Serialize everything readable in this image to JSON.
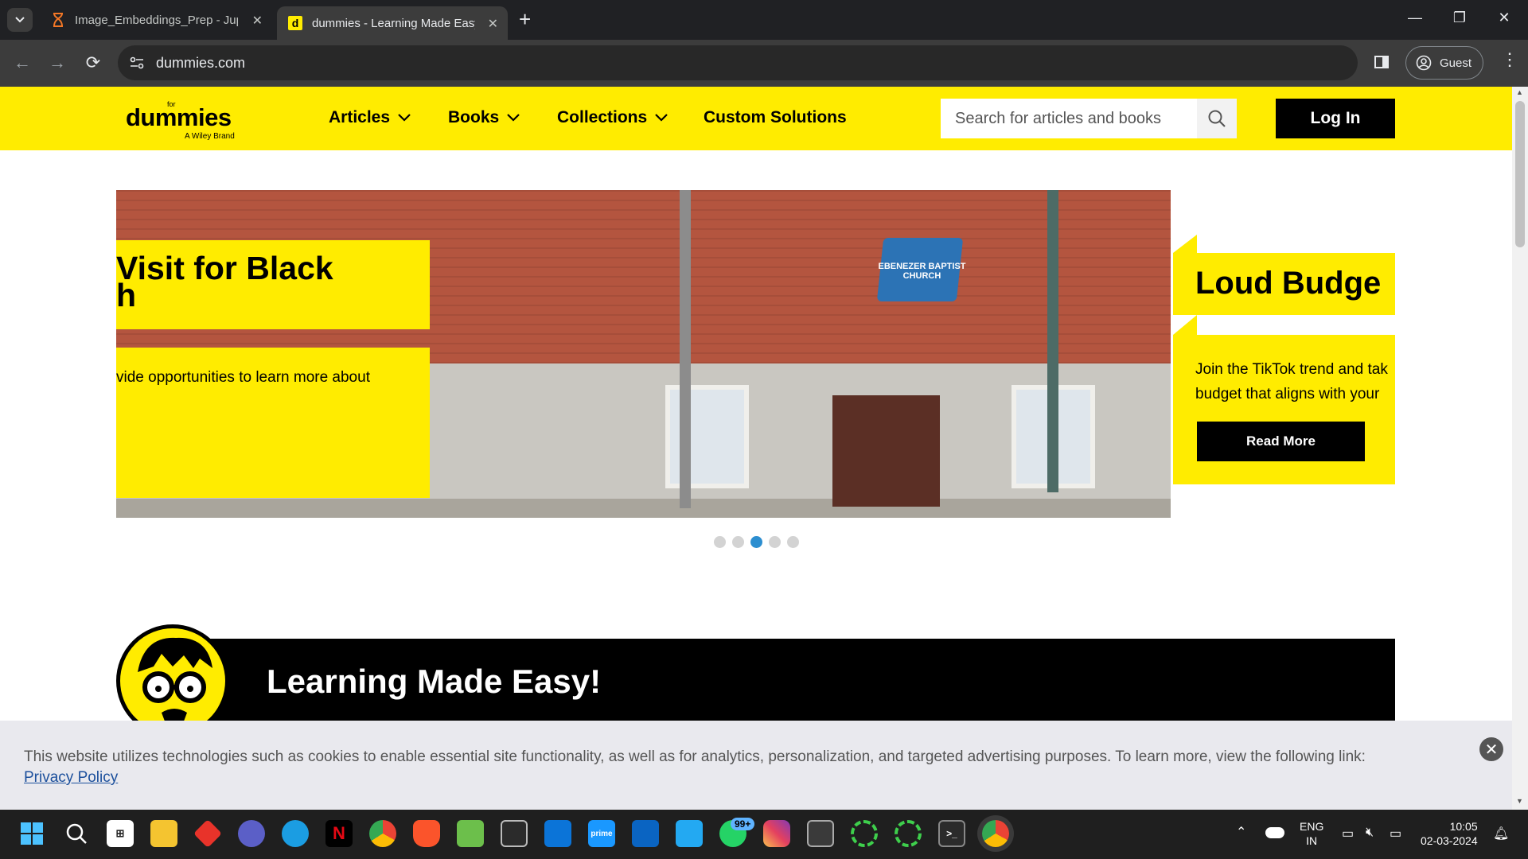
{
  "browser": {
    "tabs": [
      {
        "title": "Image_Embeddings_Prep - Jupyter",
        "icon": "hourglass-icon",
        "active": false
      },
      {
        "title": "dummies - Learning Made Easy",
        "icon": "dummies-favicon",
        "active": true
      }
    ],
    "url": "dummies.com",
    "profile_label": "Guest"
  },
  "site": {
    "logo": {
      "for": "for",
      "main": "dummies",
      "brand": "A Wiley Brand"
    },
    "nav": [
      {
        "label": "Articles",
        "has_dropdown": true
      },
      {
        "label": "Books",
        "has_dropdown": true
      },
      {
        "label": "Collections",
        "has_dropdown": true
      },
      {
        "label": "Custom Solutions",
        "has_dropdown": false
      }
    ],
    "search_placeholder": "Search for articles and books",
    "login_label": "Log In"
  },
  "carousel": {
    "left_card": {
      "title_line1": "Visit for Black",
      "title_line2": "h",
      "body": "vide opportunities to learn more about"
    },
    "right_card": {
      "title": "Loud Budge",
      "body_line1": "Join the TikTok trend and tak",
      "body_line2": "budget that aligns with your",
      "button": "Read More"
    },
    "slides": 5,
    "active_index": 2,
    "image_sign_text": "EBENEZER BAPTIST CHURCH"
  },
  "banner": {
    "title": "Learning Made Easy!"
  },
  "cookie": {
    "text": "This website utilizes technologies such as cookies to enable essential site functionality, as well as for analytics, personalization, and targeted advertising purposes. To learn more, view the following link:",
    "link": "Privacy Policy"
  },
  "taskbar": {
    "language": "ENG",
    "region": "IN",
    "time": "10:05",
    "date": "02-03-2024",
    "whatsapp_badge": "99+"
  },
  "colors": {
    "brand_yellow": "#ffec00",
    "carousel_active": "#2c8ed0"
  }
}
